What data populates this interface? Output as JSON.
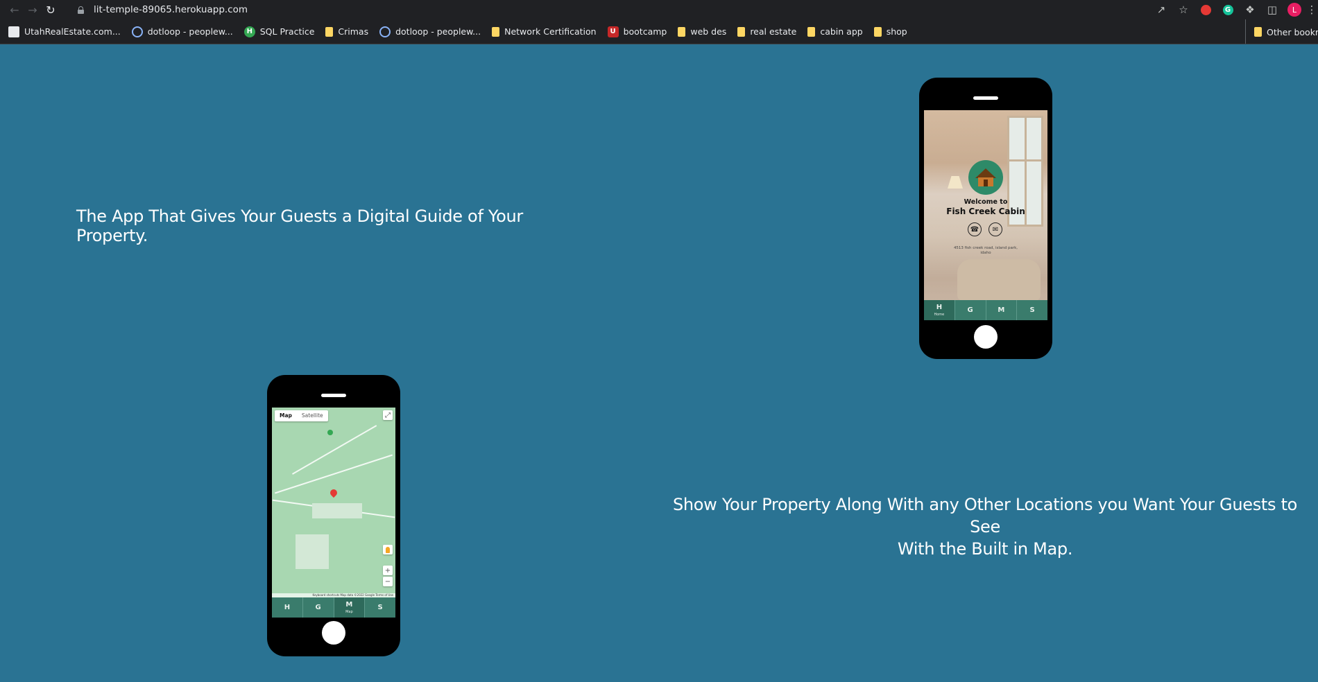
{
  "browser": {
    "url": "lit-temple-89065.herokuapp.com",
    "profile_initial": "L"
  },
  "bookmarks": [
    {
      "label": "UtahRealEstate.com...",
      "icon": "site-icon"
    },
    {
      "label": "dotloop - peoplew...",
      "icon": "dotloop-icon"
    },
    {
      "label": "SQL Practice",
      "icon": "h-icon"
    },
    {
      "label": "Crimas",
      "icon": "folder-icon"
    },
    {
      "label": "dotloop - peoplew...",
      "icon": "dotloop-icon"
    },
    {
      "label": "Network Certification",
      "icon": "folder-icon"
    },
    {
      "label": "bootcamp",
      "icon": "u-icon"
    },
    {
      "label": "web des",
      "icon": "folder-icon"
    },
    {
      "label": "real estate",
      "icon": "folder-icon"
    },
    {
      "label": "cabin app",
      "icon": "folder-icon"
    },
    {
      "label": "shop",
      "icon": "folder-icon"
    }
  ],
  "other_bookmarks": "Other bookmarks",
  "page": {
    "headline1": "The App That Gives Your Guests a Digital Guide of Your Property.",
    "headline2_line1": "Show Your Property Along With any Other Locations you Want Your Guests to See",
    "headline2_line2": "With the Built in Map."
  },
  "phone_home": {
    "welcome": "Welcome to",
    "cabin_name": "Fish Creek Cabin",
    "address": "4513 fish creek road, island park, idaho",
    "tabs": [
      {
        "letter": "H",
        "sub": "Home"
      },
      {
        "letter": "G",
        "sub": ""
      },
      {
        "letter": "M",
        "sub": ""
      },
      {
        "letter": "S",
        "sub": ""
      }
    ]
  },
  "phone_map": {
    "map_type": [
      "Map",
      "Satellite"
    ],
    "footer": "Keyboard shortcuts  Map data ©2022 Google  Terms of Use",
    "tabs": [
      {
        "letter": "H",
        "sub": ""
      },
      {
        "letter": "G",
        "sub": ""
      },
      {
        "letter": "M",
        "sub": "Map"
      },
      {
        "letter": "S",
        "sub": ""
      }
    ]
  },
  "colors": {
    "page_bg": "#2a7393",
    "tab_bar": "#3a7c6c"
  }
}
